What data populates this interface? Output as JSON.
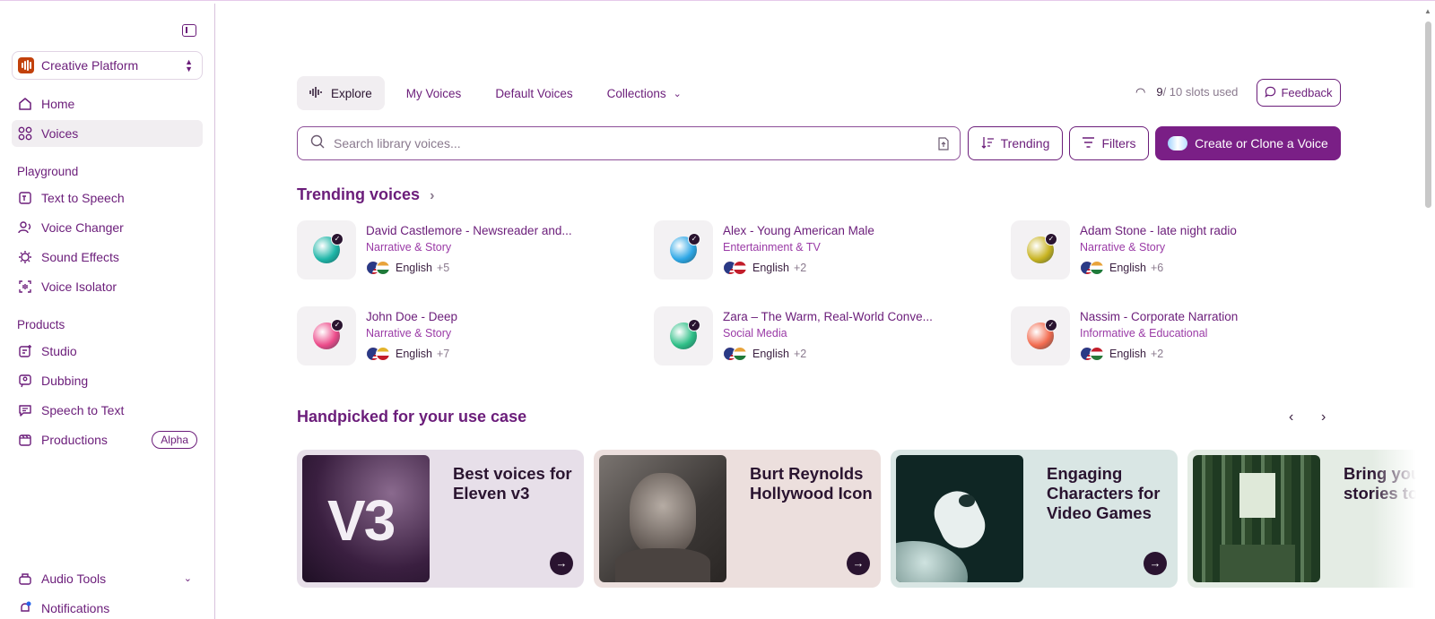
{
  "sidebar": {
    "workspace_name": "Creative Platform",
    "nav": [
      {
        "label": "Home",
        "icon": "home-icon"
      },
      {
        "label": "Voices",
        "icon": "voices-grid-icon"
      }
    ],
    "playground_label": "Playground",
    "playground": [
      {
        "label": "Text to Speech",
        "icon": "text-to-speech-icon"
      },
      {
        "label": "Voice Changer",
        "icon": "voice-changer-icon"
      },
      {
        "label": "Sound Effects",
        "icon": "sound-effects-icon"
      },
      {
        "label": "Voice Isolator",
        "icon": "voice-isolator-icon"
      }
    ],
    "products_label": "Products",
    "products": [
      {
        "label": "Studio",
        "icon": "studio-icon"
      },
      {
        "label": "Dubbing",
        "icon": "dubbing-icon"
      },
      {
        "label": "Speech to Text",
        "icon": "speech-to-text-icon"
      },
      {
        "label": "Productions",
        "icon": "productions-icon",
        "badge": "Alpha"
      }
    ],
    "audio_tools": "Audio Tools",
    "notifications": "Notifications"
  },
  "tabs": [
    "Explore",
    "My Voices",
    "Default Voices",
    "Collections"
  ],
  "slots": {
    "used": "9",
    "total_text": "/ 10 slots used"
  },
  "feedback_label": "Feedback",
  "search": {
    "placeholder": "Search library voices..."
  },
  "trending_label": "Trending",
  "filters_label": "Filters",
  "create_label": "Create or Clone a Voice",
  "trending_title": "Trending voices",
  "voices": [
    {
      "name": "David Castlemore - Newsreader and...",
      "category": "Narrative & Story",
      "lang": "English",
      "more": "+5",
      "color": "#1fb6a8"
    },
    {
      "name": "Alex - Young American Male",
      "category": "Entertainment & TV",
      "lang": "English",
      "more": "+2",
      "color": "#2ea7e6"
    },
    {
      "name": "Adam Stone - late night radio",
      "category": "Narrative & Story",
      "lang": "English",
      "more": "+6",
      "color": "#c8b320"
    },
    {
      "name": "John Doe - Deep",
      "category": "Narrative & Story",
      "lang": "English",
      "more": "+7",
      "color": "#ec4b8a"
    },
    {
      "name": "Zara – The Warm, Real-World Conve...",
      "category": "Social Media",
      "lang": "English",
      "more": "+2",
      "color": "#2fbf87"
    },
    {
      "name": "Nassim - Corporate Narration",
      "category": "Informative & Educational",
      "lang": "English",
      "more": "+2",
      "color": "#f26b4f"
    }
  ],
  "handpicked_title": "Handpicked for your use case",
  "cards": [
    {
      "title": "Best voices for Eleven v3",
      "img_text": "V3",
      "bg": "#e7dfe9"
    },
    {
      "title": "Burt Reynolds Hollywood Icon",
      "img_text": "",
      "bg": "#ecdfdd"
    },
    {
      "title": "Engaging Characters for Video Games",
      "img_text": "",
      "bg": "#d9e6e4"
    },
    {
      "title": "Bring your stories to",
      "img_text": "",
      "bg": "#e4ece4"
    }
  ]
}
